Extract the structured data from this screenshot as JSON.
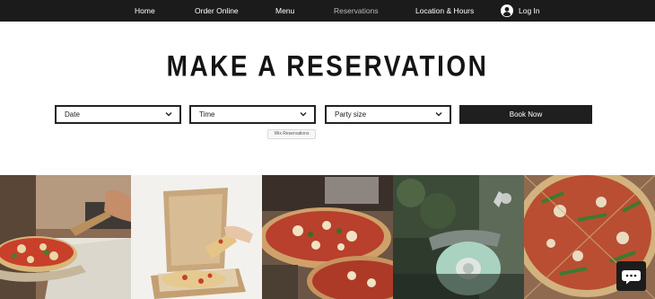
{
  "nav": {
    "items": [
      "Home",
      "Order Online",
      "Menu",
      "Reservations",
      "Location & Hours"
    ],
    "active": "Reservations",
    "login_label": "Log In"
  },
  "title": "MAKE A RESERVATION",
  "form": {
    "date_label": "Date",
    "time_label": "Time",
    "party_label": "Party size",
    "book_label": "Book Now",
    "tooltip": "Wix Reservations"
  },
  "gallery": {
    "images": [
      "pizza-peel-photo",
      "pizza-box-photo",
      "pizza-on-table-photo",
      "delivery-scooter-photo",
      "pizza-overhead-photo"
    ]
  },
  "colors": {
    "nav_bg": "#1b1b1b",
    "text_dark": "#141414",
    "button_bg": "#1f1f1f"
  }
}
